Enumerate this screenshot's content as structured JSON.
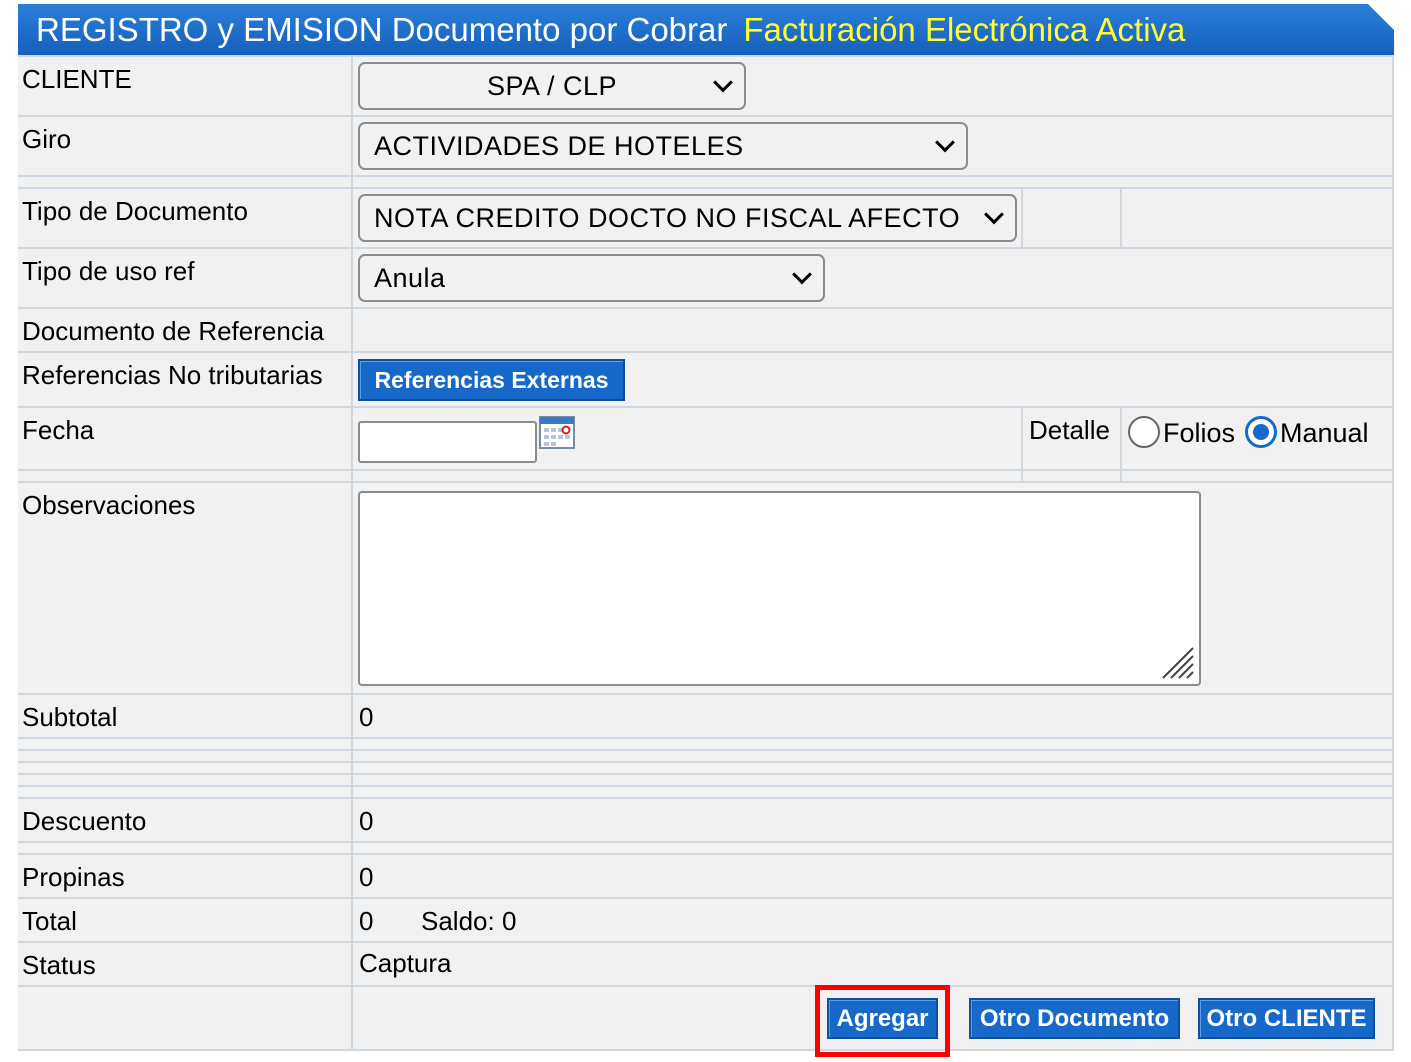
{
  "header": {
    "title": "REGISTRO y EMISION Documento por Cobrar",
    "status": "Facturación Electrónica Activa"
  },
  "cliente": {
    "label": "CLIENTE",
    "value": "SPA / CLP"
  },
  "giro": {
    "label": "Giro",
    "value": "ACTIVIDADES DE HOTELES"
  },
  "tipo_documento": {
    "label": "Tipo de Documento",
    "value": "NOTA CREDITO DOCTO NO FISCAL AFECTO"
  },
  "tipo_uso_ref": {
    "label": "Tipo de uso ref",
    "value": "Anula"
  },
  "documento_referencia": {
    "label": "Documento de Referencia"
  },
  "referencias_no_tributarias": {
    "label": "Referencias No tributarias",
    "button": "Referencias Externas"
  },
  "fecha": {
    "label": "Fecha",
    "value": ""
  },
  "detalle": {
    "label": "Detalle",
    "options": [
      {
        "label": "Folios",
        "selected": false
      },
      {
        "label": "Manual",
        "selected": true
      }
    ]
  },
  "observaciones": {
    "label": "Observaciones",
    "value": ""
  },
  "subtotal": {
    "label": "Subtotal",
    "value": "0"
  },
  "descuento": {
    "label": "Descuento",
    "value": "0"
  },
  "propinas": {
    "label": "Propinas",
    "value": "0"
  },
  "total": {
    "label": "Total",
    "value": "0",
    "saldo": "Saldo: 0"
  },
  "status": {
    "label": "Status",
    "value": "Captura"
  },
  "actions": {
    "agregar": "Agregar",
    "otro_documento": "Otro Documento",
    "otro_cliente": "Otro CLIENTE"
  },
  "colors": {
    "header": "#1560bd",
    "header_status": "#ffff33",
    "button": "#1669c8",
    "highlight": "#ff0000"
  }
}
